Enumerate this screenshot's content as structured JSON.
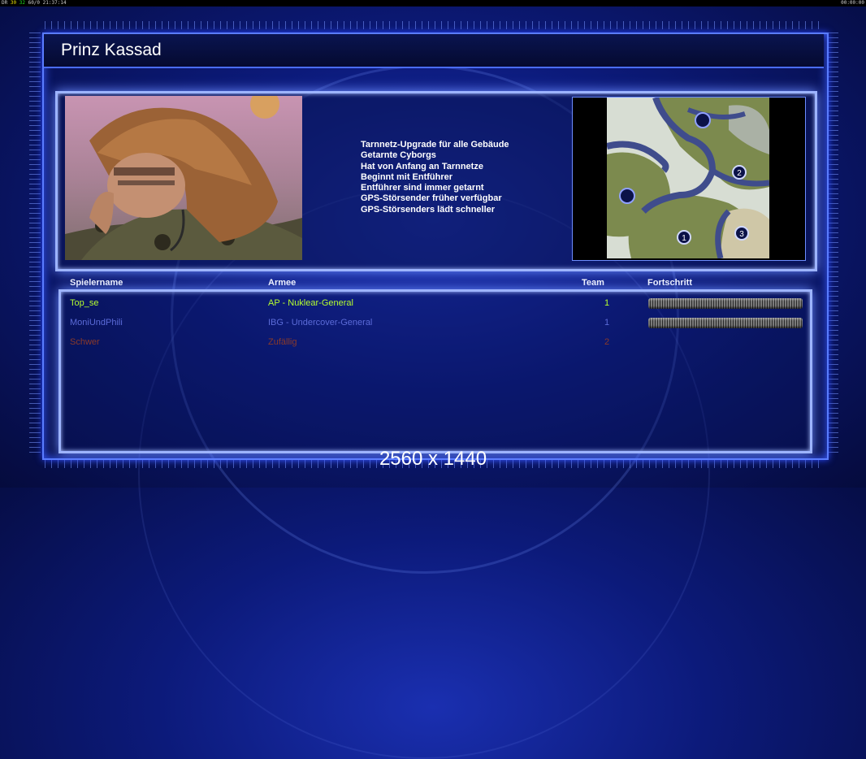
{
  "hud": {
    "left_a": "DR",
    "left_b": "30",
    "left_c": "32",
    "left_d": "60/0",
    "left_clock": "21:37:14",
    "right_clock": "00:00:00"
  },
  "general": {
    "name": "Prinz Kassad",
    "features": [
      "Tarnnetz-Upgrade für alle Gebäude",
      "Getarnte Cyborgs",
      "Hat von Anfang an Tarnnetze",
      "Beginnt mit Entführer",
      "Entführer sind immer getarnt",
      "GPS-Störsender früher verfügbar",
      "GPS-Störsenders lädt schneller"
    ]
  },
  "minimap": {
    "markers": [
      "1",
      "2",
      "3"
    ]
  },
  "table": {
    "headers": {
      "player": "Spielername",
      "army": "Armee",
      "team": "Team",
      "progress": "Fortschritt"
    },
    "rows": [
      {
        "name": "Top_se",
        "army": "AP - Nuklear-General",
        "team": "1",
        "color": "#b6ff2e",
        "progress": 1.0
      },
      {
        "name": "MoniUndPhili",
        "army": "IBG - Undercover-General",
        "team": "1",
        "color": "#5b6bd8",
        "progress": 1.0
      },
      {
        "name": "Schwer",
        "army": "Zufällig",
        "team": "2",
        "color": "#8a3a2a"
      }
    ]
  },
  "resolution_label": "2560 x 1440"
}
